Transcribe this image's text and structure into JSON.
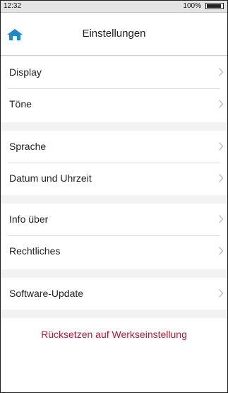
{
  "status_bar": {
    "time": "12:32",
    "battery_percent": "100%",
    "battery_level": 1.0
  },
  "header": {
    "title": "Einstellungen",
    "home_icon": "home-icon",
    "accent_color": "#1a8ccd"
  },
  "settings": {
    "groups": [
      {
        "items": [
          {
            "label": "Display"
          },
          {
            "label": "Töne"
          }
        ]
      },
      {
        "items": [
          {
            "label": "Sprache"
          },
          {
            "label": "Datum und Uhrzeit"
          }
        ]
      },
      {
        "items": [
          {
            "label": "Info über"
          },
          {
            "label": "Rechtliches"
          }
        ]
      },
      {
        "items": [
          {
            "label": "Software-Update"
          }
        ]
      }
    ],
    "chevron_icon": "chevron-right-icon"
  },
  "reset": {
    "label": "Rücksetzen auf Werkseinstellung",
    "color": "#c8102e"
  }
}
